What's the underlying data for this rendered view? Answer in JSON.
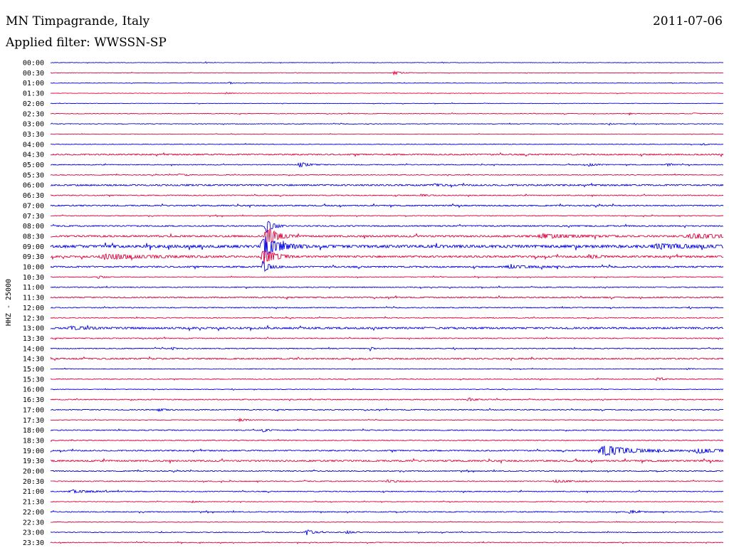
{
  "header": {
    "station": "MN Timpagrande, Italy",
    "date": "2011-07-06",
    "filter": "Applied filter: WWSSN-SP"
  },
  "chart_data": {
    "type": "line",
    "title": "MN Timpagrande, Italy",
    "ylabel": "HHZ - 25000",
    "colors": {
      "even_rows": "#0000e0",
      "odd_rows": "#e0003c"
    },
    "rows": [
      {
        "label": "00:00",
        "amp": 0.3,
        "events": [
          {
            "pos": 0.23,
            "amp": 1.5,
            "width": 0.002
          }
        ]
      },
      {
        "label": "00:30",
        "amp": 0.3,
        "events": [
          {
            "pos": 0.51,
            "amp": 2.5,
            "width": 0.01
          }
        ]
      },
      {
        "label": "01:00",
        "amp": 0.3,
        "events": [
          {
            "pos": 0.265,
            "amp": 2.0,
            "width": 0.004
          }
        ]
      },
      {
        "label": "01:30",
        "amp": 0.3,
        "events": [
          {
            "pos": 0.26,
            "amp": 1.5,
            "width": 0.006
          }
        ]
      },
      {
        "label": "02:00",
        "amp": 0.3,
        "events": []
      },
      {
        "label": "02:30",
        "amp": 0.4,
        "events": [
          {
            "pos": 0.86,
            "amp": 1.5,
            "width": 0.003
          },
          {
            "pos": 0.955,
            "amp": 1.5,
            "width": 0.005
          }
        ]
      },
      {
        "label": "03:00",
        "amp": 0.4,
        "events": [
          {
            "pos": 0.83,
            "amp": 2.0,
            "width": 0.003
          }
        ]
      },
      {
        "label": "03:30",
        "amp": 0.3,
        "events": []
      },
      {
        "label": "04:00",
        "amp": 0.4,
        "events": [
          {
            "pos": 0.97,
            "amp": 1.5,
            "width": 0.006
          }
        ]
      },
      {
        "label": "04:30",
        "amp": 0.9,
        "events": []
      },
      {
        "label": "05:00",
        "amp": 0.5,
        "events": [
          {
            "pos": 0.37,
            "amp": 4.0,
            "width": 0.012
          },
          {
            "pos": 0.8,
            "amp": 2.0,
            "width": 0.012
          },
          {
            "pos": 0.915,
            "amp": 1.8,
            "width": 0.008
          }
        ]
      },
      {
        "label": "05:30",
        "amp": 0.5,
        "events": [
          {
            "pos": 0.19,
            "amp": 1.5,
            "width": 0.01
          }
        ]
      },
      {
        "label": "06:00",
        "amp": 1.0,
        "events": [
          {
            "pos": 0.57,
            "amp": 1.6,
            "width": 0.008
          }
        ]
      },
      {
        "label": "06:30",
        "amp": 0.6,
        "events": [
          {
            "pos": 0.55,
            "amp": 1.4,
            "width": 0.01
          }
        ]
      },
      {
        "label": "07:00",
        "amp": 0.8,
        "events": []
      },
      {
        "label": "07:30",
        "amp": 0.5,
        "events": []
      },
      {
        "label": "08:00",
        "amp": 0.8,
        "events": [
          {
            "pos": 0.32,
            "amp": 10.0,
            "width": 0.01
          }
        ]
      },
      {
        "label": "08:30",
        "amp": 1.2,
        "events": [
          {
            "pos": 0.32,
            "amp": 14.0,
            "width": 0.015
          },
          {
            "pos": 0.73,
            "amp": 2.8,
            "width": 0.04
          },
          {
            "pos": 0.95,
            "amp": 2.8,
            "width": 0.06
          }
        ]
      },
      {
        "label": "09:00",
        "amp": 1.8,
        "events": [
          {
            "pos": 0.315,
            "amp": 16.0,
            "width": 0.022
          },
          {
            "pos": 0.9,
            "amp": 3.0,
            "width": 0.05
          }
        ]
      },
      {
        "label": "09:30",
        "amp": 1.2,
        "events": [
          {
            "pos": 0.08,
            "amp": 3.5,
            "width": 0.06
          },
          {
            "pos": 0.315,
            "amp": 13.0,
            "width": 0.015
          },
          {
            "pos": 0.8,
            "amp": 2.5,
            "width": 0.012
          }
        ]
      },
      {
        "label": "10:00",
        "amp": 1.0,
        "events": [
          {
            "pos": 0.315,
            "amp": 8.0,
            "width": 0.01
          },
          {
            "pos": 0.68,
            "amp": 1.8,
            "width": 0.03
          }
        ]
      },
      {
        "label": "10:30",
        "amp": 0.5,
        "events": [
          {
            "pos": 0.07,
            "amp": 2.0,
            "width": 0.008
          }
        ]
      },
      {
        "label": "11:00",
        "amp": 0.6,
        "events": []
      },
      {
        "label": "11:30",
        "amp": 0.8,
        "events": []
      },
      {
        "label": "12:00",
        "amp": 0.6,
        "events": []
      },
      {
        "label": "12:30",
        "amp": 0.6,
        "events": []
      },
      {
        "label": "13:00",
        "amp": 1.2,
        "events": [
          {
            "pos": 0.03,
            "amp": 1.8,
            "width": 0.03
          }
        ]
      },
      {
        "label": "13:30",
        "amp": 0.6,
        "events": []
      },
      {
        "label": "14:00",
        "amp": 0.6,
        "events": [
          {
            "pos": 0.18,
            "amp": 3.0,
            "width": 0.003
          },
          {
            "pos": 0.475,
            "amp": 3.0,
            "width": 0.003
          }
        ]
      },
      {
        "label": "14:30",
        "amp": 0.9,
        "events": []
      },
      {
        "label": "15:00",
        "amp": 0.4,
        "events": [
          {
            "pos": 0.945,
            "amp": 1.5,
            "width": 0.006
          }
        ]
      },
      {
        "label": "15:30",
        "amp": 0.5,
        "events": [
          {
            "pos": 0.9,
            "amp": 2.0,
            "width": 0.01
          }
        ]
      },
      {
        "label": "16:00",
        "amp": 0.4,
        "events": []
      },
      {
        "label": "16:30",
        "amp": 0.6,
        "events": [
          {
            "pos": 0.62,
            "amp": 1.8,
            "width": 0.012
          }
        ]
      },
      {
        "label": "17:00",
        "amp": 0.6,
        "events": [
          {
            "pos": 0.16,
            "amp": 2.0,
            "width": 0.01
          }
        ]
      },
      {
        "label": "17:30",
        "amp": 0.4,
        "events": [
          {
            "pos": 0.28,
            "amp": 1.8,
            "width": 0.012
          }
        ]
      },
      {
        "label": "18:00",
        "amp": 0.6,
        "events": [
          {
            "pos": 0.315,
            "amp": 3.0,
            "width": 0.006
          }
        ]
      },
      {
        "label": "18:30",
        "amp": 0.5,
        "events": []
      },
      {
        "label": "19:00",
        "amp": 0.8,
        "events": [
          {
            "pos": 0.82,
            "amp": 8.0,
            "width": 0.04
          },
          {
            "pos": 0.96,
            "amp": 3.5,
            "width": 0.03
          }
        ]
      },
      {
        "label": "19:30",
        "amp": 1.0,
        "events": []
      },
      {
        "label": "20:00",
        "amp": 0.6,
        "events": []
      },
      {
        "label": "20:30",
        "amp": 0.6,
        "events": [
          {
            "pos": 0.5,
            "amp": 1.6,
            "width": 0.015
          },
          {
            "pos": 0.75,
            "amp": 1.6,
            "width": 0.02
          }
        ]
      },
      {
        "label": "21:00",
        "amp": 0.6,
        "events": [
          {
            "pos": 0.03,
            "amp": 1.8,
            "width": 0.03
          }
        ]
      },
      {
        "label": "21:30",
        "amp": 0.4,
        "events": [
          {
            "pos": 0.21,
            "amp": 1.4,
            "width": 0.006
          }
        ]
      },
      {
        "label": "22:00",
        "amp": 0.6,
        "events": [
          {
            "pos": 0.86,
            "amp": 1.8,
            "width": 0.01
          }
        ]
      },
      {
        "label": "22:30",
        "amp": 0.4,
        "events": []
      },
      {
        "label": "23:00",
        "amp": 0.5,
        "events": [
          {
            "pos": 0.38,
            "amp": 5.0,
            "width": 0.008
          },
          {
            "pos": 0.44,
            "amp": 2.2,
            "width": 0.008
          }
        ]
      },
      {
        "label": "23:30",
        "amp": 0.5,
        "events": []
      }
    ]
  }
}
